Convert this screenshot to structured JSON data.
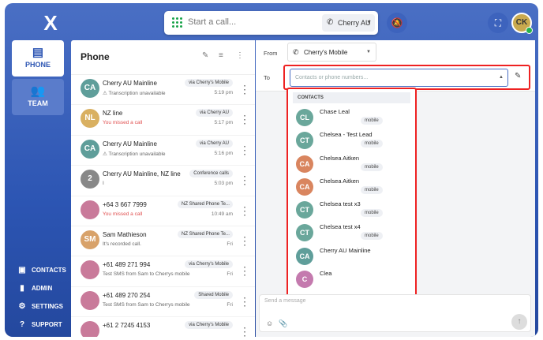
{
  "topbar": {
    "logo": "X",
    "call_placeholder": "Start a call...",
    "account": "Cherry AU",
    "avatar_initials": "CK"
  },
  "nav": {
    "items": [
      {
        "label": "PHONE",
        "icon": "chat-icon",
        "active": true
      },
      {
        "label": "TEAM",
        "icon": "team-icon",
        "active": false
      }
    ],
    "bottom": [
      {
        "label": "CONTACTS",
        "icon": "contacts-icon"
      },
      {
        "label": "ADMIN",
        "icon": "bar-chart-icon"
      },
      {
        "label": "SETTINGS",
        "icon": "gear-icon"
      },
      {
        "label": "SUPPORT",
        "icon": "help-icon"
      }
    ]
  },
  "phone": {
    "title": "Phone",
    "rows": [
      {
        "initials": "CA",
        "color": "#5f9e9a",
        "name": "Cherry AU Mainline",
        "tag": "via Cherry's Mobile",
        "sub": "⚠ Transcription unavailable",
        "missed": false,
        "time": "5:19 pm"
      },
      {
        "initials": "NL",
        "color": "#d9b061",
        "name": "NZ line",
        "tag": "via Cherry AU",
        "sub": "You missed a call",
        "missed": true,
        "time": "5:17 pm"
      },
      {
        "initials": "CA",
        "color": "#5f9e9a",
        "name": "Cherry AU Mainline",
        "tag": "via Cherry AU",
        "sub": "⚠ Transcription unavailable",
        "missed": false,
        "time": "5:16 pm"
      },
      {
        "initials": "2",
        "color": "#888888",
        "name": "Cherry AU Mainline, NZ line",
        "tag": "Conference calls",
        "sub": "I",
        "missed": false,
        "time": "5:03 pm"
      },
      {
        "initials": "",
        "color": "#c97a9a",
        "name": "+64 3 667 7999",
        "tag": "NZ Shared Phone Te...",
        "sub": "You missed a call",
        "missed": true,
        "time": "10:49 am"
      },
      {
        "initials": "SM",
        "color": "#d8a26a",
        "name": "Sam Mathieson",
        "tag": "NZ Shared Phone Te...",
        "sub": "It's recorded call.",
        "missed": false,
        "time": "Fri"
      },
      {
        "initials": "",
        "color": "#c97a9a",
        "name": "+61 489 271 994",
        "tag": "via Cherry's Mobile",
        "sub": "Test SMS from Sam to Cherrys mobile",
        "missed": false,
        "time": "Fri"
      },
      {
        "initials": "",
        "color": "#c97a9a",
        "name": "+61 489 270 254",
        "tag": "Shared Mobile",
        "sub": "Test SMS from Sam to Cherrys mobile",
        "missed": false,
        "time": "Fri"
      },
      {
        "initials": "",
        "color": "#c97a9a",
        "name": "+61 2 7245 4153",
        "tag": "via Cherry's Mobile",
        "sub": "",
        "missed": false,
        "time": ""
      }
    ]
  },
  "compose": {
    "from_label": "From",
    "from_value": "Cherry's Mobile",
    "to_label": "To",
    "to_placeholder": "Contacts or phone numbers...",
    "message_placeholder": "Send a message",
    "contacts_heading": "CONTACTS",
    "contacts": [
      {
        "initials": "CL",
        "color": "#6aa79b",
        "name": "Chase Leal",
        "type": "mobile"
      },
      {
        "initials": "CT",
        "color": "#6aa79b",
        "name": "Chelsea - Test Lead",
        "type": "mobile"
      },
      {
        "initials": "CA",
        "color": "#d9855f",
        "name": "Chelsea Aitken",
        "type": "mobile"
      },
      {
        "initials": "CA",
        "color": "#d9855f",
        "name": "Chelsea Aitken",
        "type": "mobile"
      },
      {
        "initials": "CT",
        "color": "#6aa79b",
        "name": "Chelsea test x3",
        "type": "mobile"
      },
      {
        "initials": "CT",
        "color": "#6aa79b",
        "name": "Chelsea test x4",
        "type": "mobile"
      },
      {
        "initials": "CA",
        "color": "#5f9e9a",
        "name": "Cherry AU Mainline",
        "type": ""
      },
      {
        "initials": "C",
        "color": "#c47aae",
        "name": "Clea",
        "type": ""
      }
    ]
  }
}
